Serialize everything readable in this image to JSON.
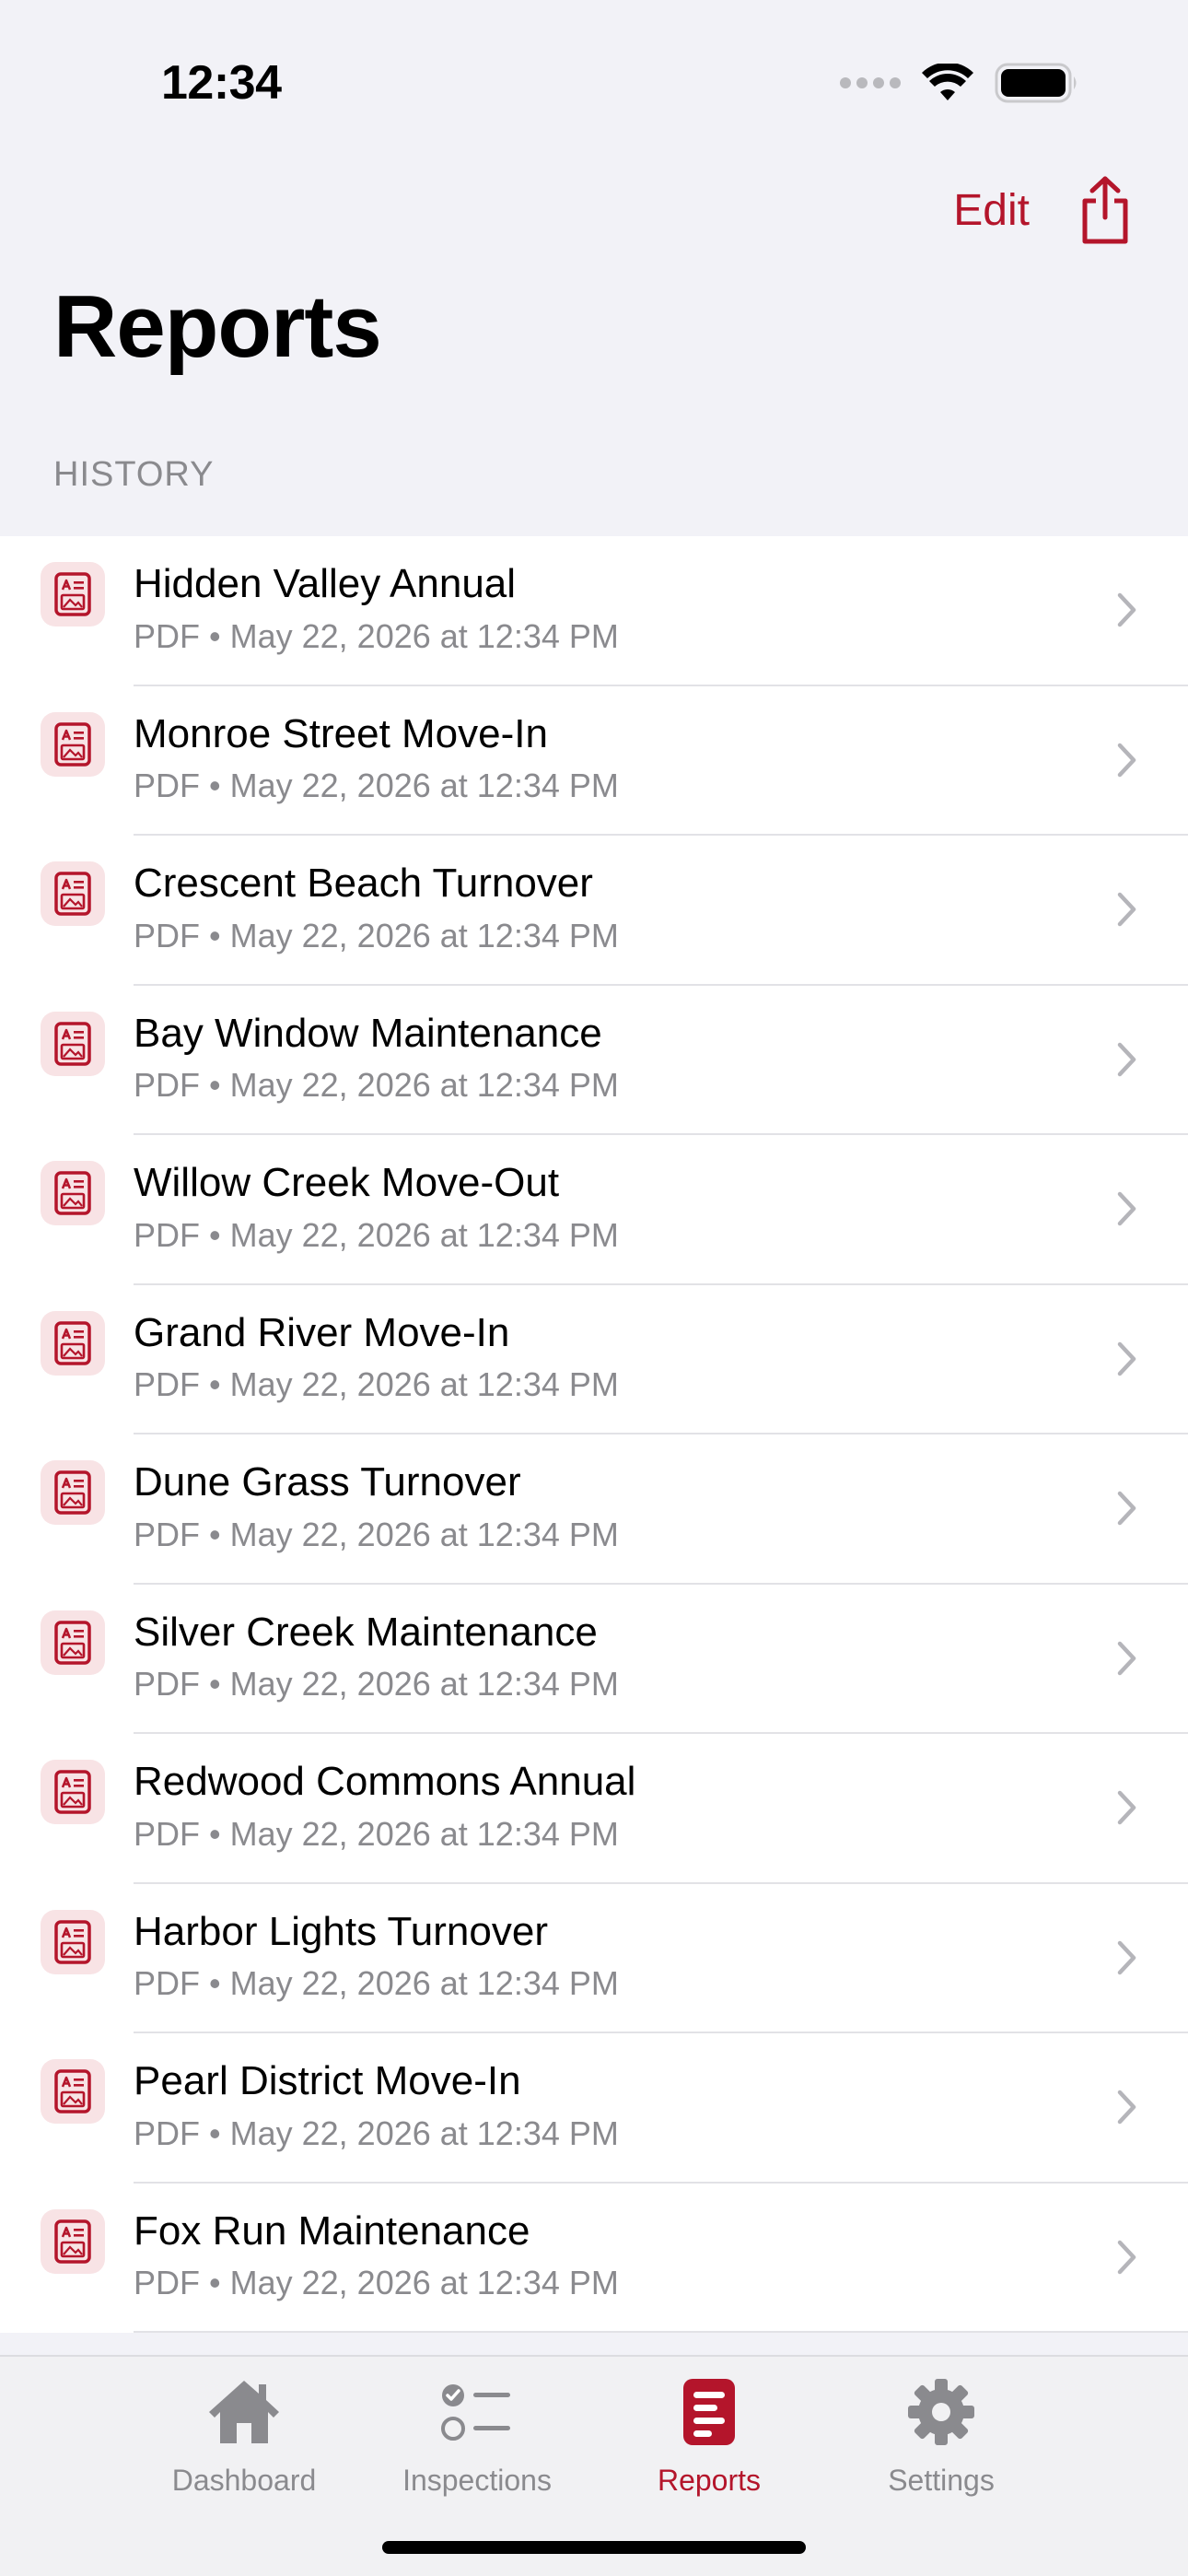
{
  "status_bar": {
    "time": "12:34"
  },
  "nav": {
    "edit_label": "Edit",
    "title": "Reports"
  },
  "section": {
    "header": "HISTORY"
  },
  "reports": [
    {
      "title": "Hidden Valley Annual",
      "subtitle": "PDF • May 22, 2026 at 12:34 PM"
    },
    {
      "title": "Monroe Street Move-In",
      "subtitle": "PDF • May 22, 2026 at 12:34 PM"
    },
    {
      "title": "Crescent Beach Turnover",
      "subtitle": "PDF • May 22, 2026 at 12:34 PM"
    },
    {
      "title": "Bay Window Maintenance",
      "subtitle": "PDF • May 22, 2026 at 12:34 PM"
    },
    {
      "title": "Willow Creek Move-Out",
      "subtitle": "PDF • May 22, 2026 at 12:34 PM"
    },
    {
      "title": "Grand River Move-In",
      "subtitle": "PDF • May 22, 2026 at 12:34 PM"
    },
    {
      "title": "Dune Grass Turnover",
      "subtitle": "PDF • May 22, 2026 at 12:34 PM"
    },
    {
      "title": "Silver Creek Maintenance",
      "subtitle": "PDF • May 22, 2026 at 12:34 PM"
    },
    {
      "title": "Redwood Commons Annual",
      "subtitle": "PDF • May 22, 2026 at 12:34 PM"
    },
    {
      "title": "Harbor Lights Turnover",
      "subtitle": "PDF • May 22, 2026 at 12:34 PM"
    },
    {
      "title": "Pearl District Move-In",
      "subtitle": "PDF • May 22, 2026 at 12:34 PM"
    },
    {
      "title": "Fox Run Maintenance",
      "subtitle": "PDF • May 22, 2026 at 12:34 PM"
    }
  ],
  "tabs": [
    {
      "label": "Dashboard",
      "icon": "house-icon"
    },
    {
      "label": "Inspections",
      "icon": "checklist-icon"
    },
    {
      "label": "Reports",
      "icon": "report-icon"
    },
    {
      "label": "Settings",
      "icon": "gear-icon"
    }
  ],
  "active_tab": "Reports",
  "colors": {
    "accent": "#b4152b",
    "secondary_text": "#8a8a8e",
    "background": "#f2f2f7",
    "icon_tile": "#f8e3e5"
  }
}
